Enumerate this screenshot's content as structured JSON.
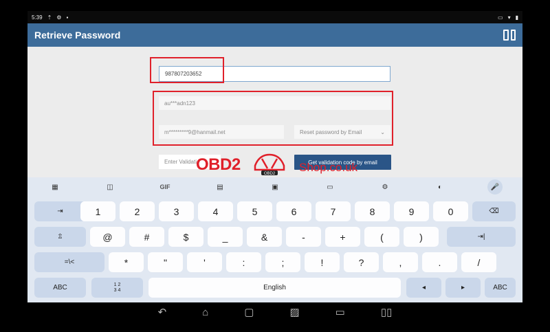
{
  "status_bar": {
    "time": "5:39"
  },
  "header": {
    "title": "Retrieve Password"
  },
  "form": {
    "phone_value": "987807203652",
    "email_masked": "au***adn123",
    "email_full_masked": "m*********9@hanmail.net",
    "reset_method": "Reset password by Email",
    "validation_placeholder": "Enter Validati",
    "get_code_button": "Get validation code by email"
  },
  "watermark": {
    "brand": "OBD2",
    "suffix": "Shop.co.uk",
    "badge": "OBD2"
  },
  "keyboard": {
    "toolbar": [
      "apps-grid",
      "sticker",
      "GIF",
      "clipboard",
      "one-hand",
      "emoji-kbd",
      "settings",
      "theme",
      "mic"
    ],
    "gif_label": "GIF",
    "row1": [
      "⇥",
      "1",
      "2",
      "3",
      "4",
      "5",
      "6",
      "7",
      "8",
      "9",
      "0",
      "⌫"
    ],
    "row2": [
      "⇫",
      "@",
      "#",
      "$",
      "_",
      "&",
      "-",
      "+",
      "(",
      ")",
      "⇥|"
    ],
    "row3": [
      "=\\<",
      "*",
      "\"",
      "'",
      ":",
      ";",
      "!",
      "?",
      ",",
      ".",
      "/"
    ],
    "row4": {
      "abc_left": "ABC",
      "numpad": "1 2\n3 4",
      "space": "English",
      "left": "◂",
      "right": "▸",
      "abc_right": "ABC"
    }
  },
  "colors": {
    "header": "#3d6c9a",
    "accent": "#2a5587",
    "annotation": "#e0202a",
    "keyboard": "#e1e8f2"
  }
}
